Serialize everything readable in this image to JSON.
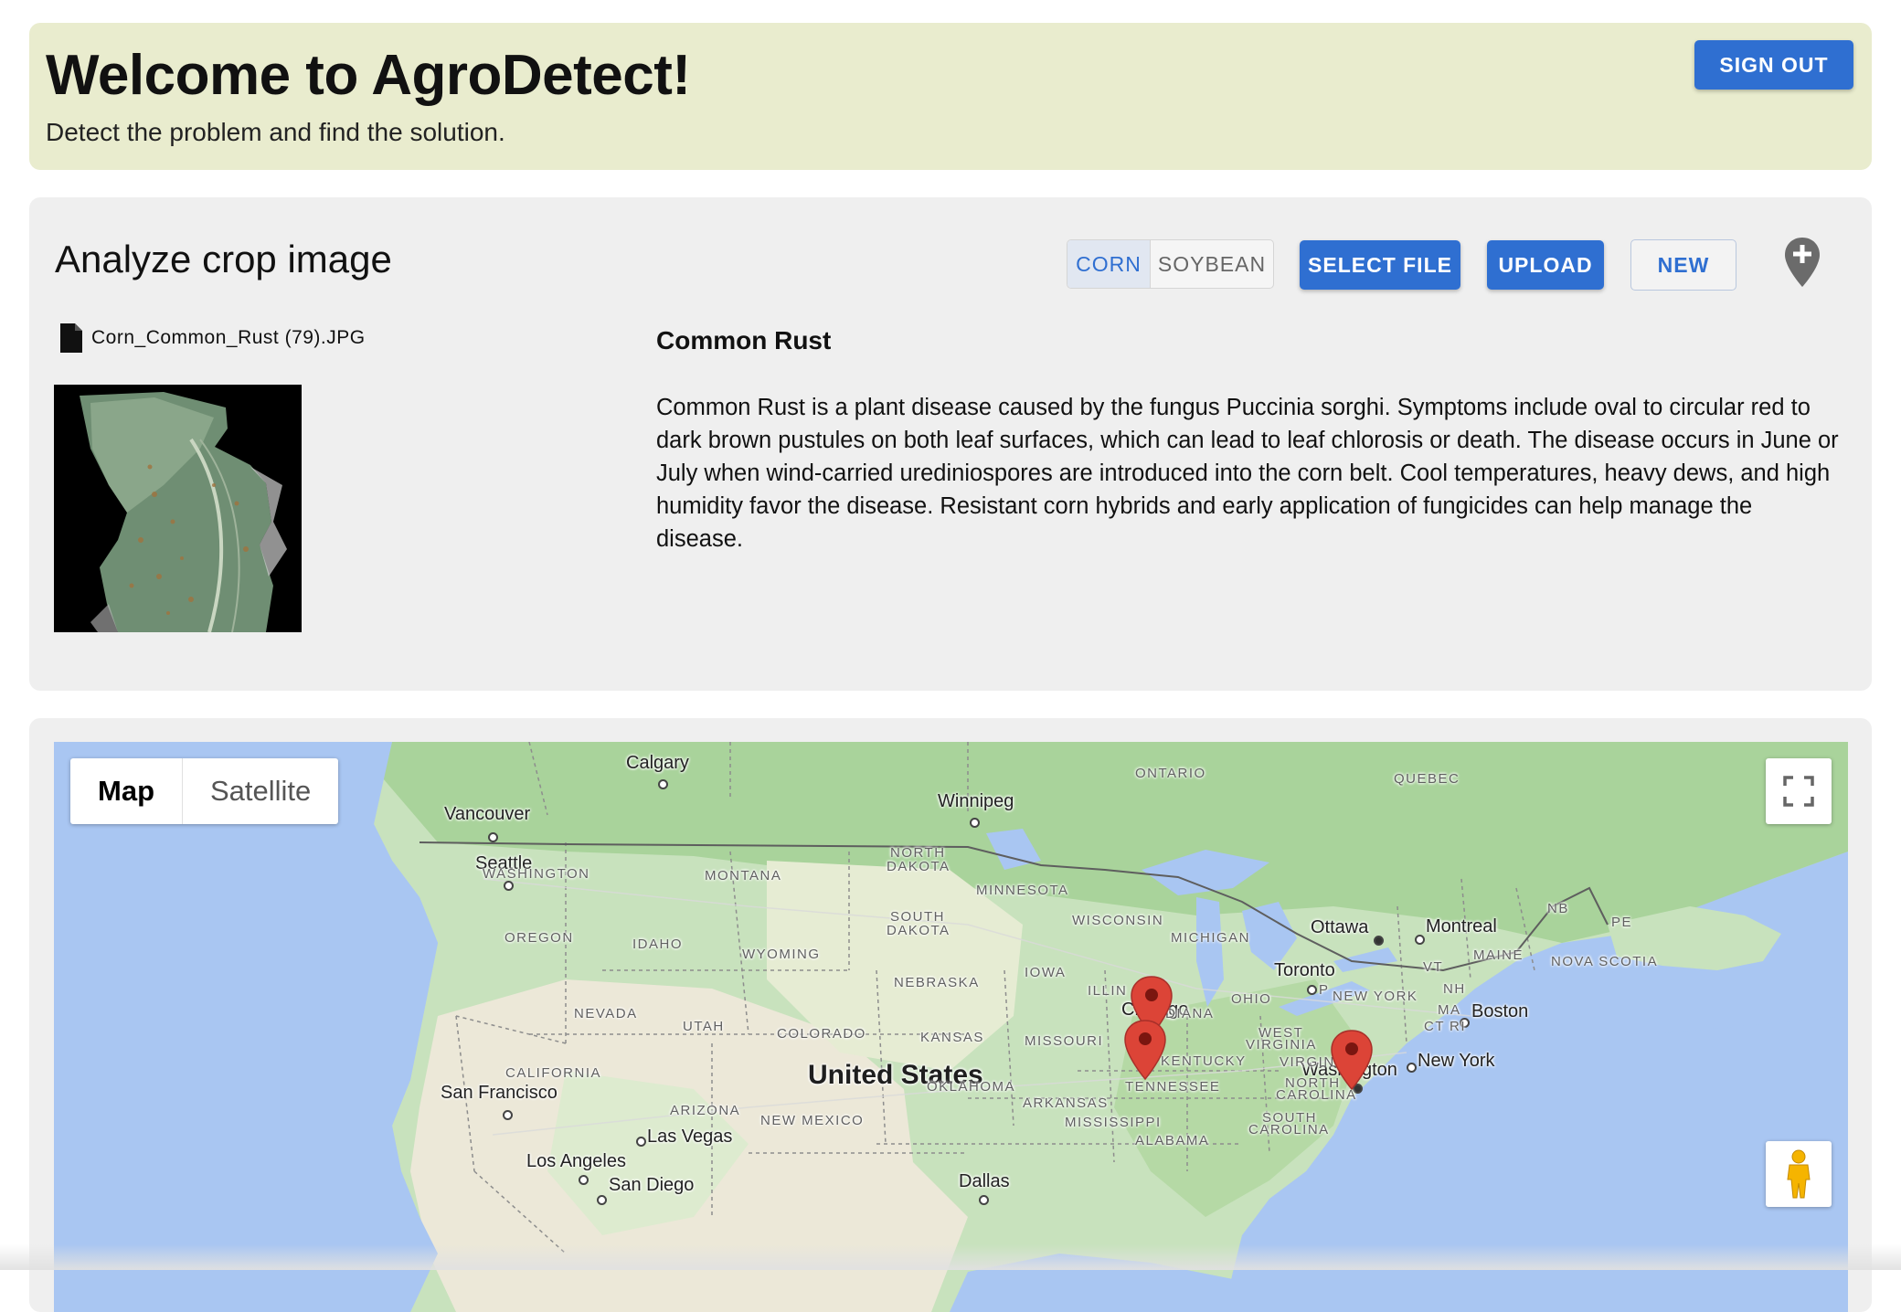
{
  "header": {
    "title": "Welcome to AgroDetect!",
    "subtitle": "Detect the problem and find the solution.",
    "sign_out_label": "SIGN OUT"
  },
  "analyze": {
    "title": "Analyze crop image",
    "crop_toggle": {
      "options": [
        "CORN",
        "SOYBEAN"
      ],
      "selected": "CORN"
    },
    "select_file_label": "SELECT FILE",
    "upload_label": "UPLOAD",
    "new_label": "NEW",
    "file_name": "Corn_Common_Rust (79).JPG",
    "result": {
      "disease_name": "Common Rust",
      "description": "Common Rust is a plant disease caused by the fungus Puccinia sorghi. Symptoms include oval to circular red to dark brown pustules on both leaf surfaces, which can lead to leaf chlorosis or death. The disease occurs in June or July when wind-carried urediniospores are introduced into the corn belt. Cool temperatures, heavy dews, and high humidity favor the disease. Resistant corn hybrids and early application of fungicides can help manage the disease."
    }
  },
  "map": {
    "type_control": {
      "map_label": "Map",
      "satellite_label": "Satellite",
      "selected": "Map"
    },
    "country_label": "United States",
    "cities": {
      "calgary": "Calgary",
      "winnipeg": "Winnipeg",
      "vancouver": "Vancouver",
      "seattle": "Seattle",
      "ottawa": "Ottawa",
      "montreal": "Montreal",
      "toronto": "Toronto",
      "boston": "Boston",
      "chicago": "Chicago",
      "new_york": "New York",
      "washington": "Washington",
      "san_francisco": "San Francisco",
      "las_vegas": "Las Vegas",
      "los_angeles": "Los Angeles",
      "san_diego": "San Diego",
      "dallas": "Dallas"
    },
    "regions": {
      "ontario": "ONTARIO",
      "quebec": "QUEBEC",
      "nb": "NB",
      "pe": "PE",
      "nova_scotia": "NOVA SCOTIA",
      "maine": "MAINE",
      "vt": "VT",
      "nh": "NH",
      "ma": "MA",
      "ct": "CT",
      "ri": "RI",
      "new_york_state": "NEW YORK",
      "washington_state": "WASHINGTON",
      "oregon": "OREGON",
      "idaho": "IDAHO",
      "montana": "MONTANA",
      "north_dakota_1": "NORTH",
      "north_dakota_2": "DAKOTA",
      "south_dakota_1": "SOUTH",
      "south_dakota_2": "DAKOTA",
      "wyoming": "WYOMING",
      "minnesota": "MINNESOTA",
      "wisconsin": "WISCONSIN",
      "michigan": "MICHIGAN",
      "iowa": "IOWA",
      "nebraska": "NEBRASKA",
      "illinois": "ILLIN",
      "indiana": "INDIANA",
      "ohio": "OHIO",
      "pennsylvania": "P",
      "nevada": "NEVADA",
      "utah": "UTAH",
      "colorado": "COLORADO",
      "kansas": "KANSAS",
      "missouri": "MISSOURI",
      "kentucky": "KENTUCKY",
      "west_virginia_1": "WEST",
      "west_virginia_2": "VIRGINIA",
      "virginia": "VIRGINIA",
      "california": "CALIFORNIA",
      "arizona": "ARIZONA",
      "new_mexico": "NEW MEXICO",
      "oklahoma": "OKLAHOMA",
      "arkansas": "ARKANSAS",
      "tennessee": "TENNESSEE",
      "north_carolina_1": "NORTH",
      "north_carolina_2": "CAROLINA",
      "south_carolina_1": "SOUTH",
      "south_carolina_2": "CAROLINA",
      "mississippi": "MISSISSIPPI",
      "alabama": "ALABAMA"
    },
    "markers": [
      "Chicago area (north)",
      "Chicago area (south)",
      "Washington"
    ]
  },
  "colors": {
    "accent": "#2f6fd1",
    "header_bg": "#e9ecce",
    "card_bg": "#efefef",
    "marker": "#dc4437"
  }
}
